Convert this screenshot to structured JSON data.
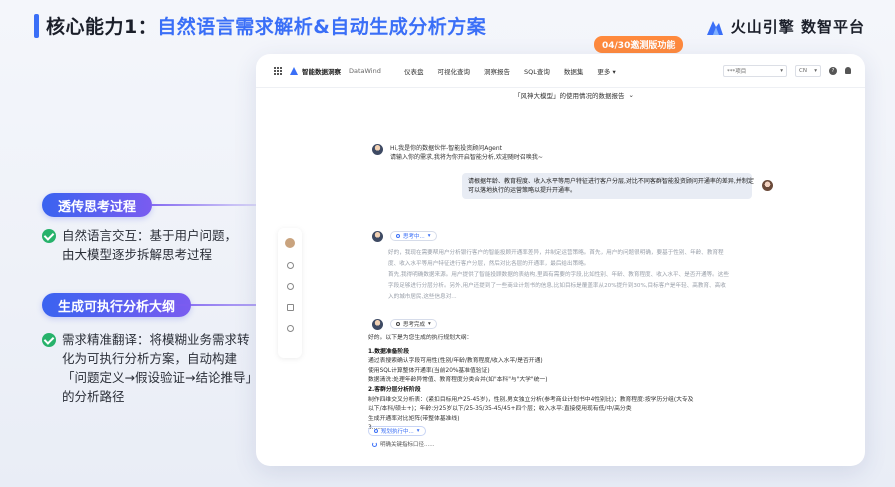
{
  "slide": {
    "title_prefix": "核心能力1：",
    "title_main": "自然语言需求解析&自动生成分析方案",
    "brand": "火山引擎 数智平台",
    "version_badge": "04/30邀测版功能"
  },
  "features": [
    {
      "pill": "透传思考过程",
      "lines": [
        "自然语言交互：基于用户问题，",
        "由大模型逐步拆解思考过程"
      ]
    },
    {
      "pill": "生成可执行分析大纲",
      "lines": [
        "需求精准翻译：将模糊业务需求转",
        "化为可执行分析方案，自动构建",
        "「问题定义→假设验证→结论推导」",
        "的分析路径"
      ]
    }
  ],
  "app": {
    "brand": "智能数据洞察",
    "brand_sub": "DataWind",
    "nav": [
      "仪表盘",
      "可视化查询",
      "洞察报告",
      "SQL查询",
      "数据集",
      "更多 ▾"
    ],
    "project_select": "***项目",
    "lang_select": "CN",
    "help_icon_glyph": "?",
    "conversation_title": "「风神大模型」的使用情况的数据报告",
    "greeting_lines": [
      "Hi,我是你的数据伙伴-智能投资顾问Agent",
      "请输入你的需求,我将为你开启智能分析,欢迎随时召唤我~"
    ],
    "user_query_lines": [
      "请根据年龄、教育程度、收入水平等用户特征进行客户分层,对比不同客群智能投资顾问开通率的差异,并制定",
      "可以落地执行的运营策略以提升开通率。"
    ],
    "thinking_chip": "思考中...",
    "thinking_lines": [
      "好的，我现在需要帮用户分析银行客户的智能投顾开通率差异，并制定运营策略。首先，用户的问题很明确，要基于性别、年龄、教育程",
      "度、收入水平等用户特征进行客户分层，然后对比各层的开通率，最后给出策略。",
      "首先,我得明确数据来源。用户提供了智能投顾数据的表结构,里面有需要的字段,比如性别、年龄、教育程度、收入水平、是否开通等。这些",
      "字段足够进行分层分析。另外,用户还提到了一些商业计划书的信息,比如目标是覆盖率从20%提升到30%,目标客户是年轻、高教育、高收",
      "入的城市居民,这些信息对..."
    ],
    "done_chip": "思考完成",
    "plan_intro": "好的。以下是为您生成的执行规划大纲：",
    "plan_lines": [
      {
        "text": "1.数据准备阶段",
        "heading": true
      },
      {
        "text": "通过表搜索确认字段可用性(性别/年龄/教育程度/收入水平/是否开通)",
        "heading": false
      },
      {
        "text": "使用SQL计算整体开通率(当前20%基准值验证)",
        "heading": false
      },
      {
        "text": "数据清洗:处理年龄异常值、教育程度分类合并(如\"本科\"与\"大学\"统一)",
        "heading": false
      },
      {
        "text": "2.客群分层分析阶段",
        "heading": true
      },
      {
        "text": "制作四维交叉分析表：(紧扣目标用户25-45岁)，性别,男女独立分析(参考商业计划书中4性别比)；教育程度:按学历分组(大专及",
        "heading": false
      },
      {
        "text": "以下/本科/硕士+)；年龄:分25岁以下/25-35/35-45/45+四个层；收入水平:直接使用现有低/中/高分类",
        "heading": false
      },
      {
        "text": "生成开通率对比矩阵(带整体基准线)",
        "heading": false
      },
      {
        "text": "3......",
        "heading": false
      }
    ],
    "exec_chip": "规划执行中...",
    "status_line": "明确关键指标口径......"
  }
}
